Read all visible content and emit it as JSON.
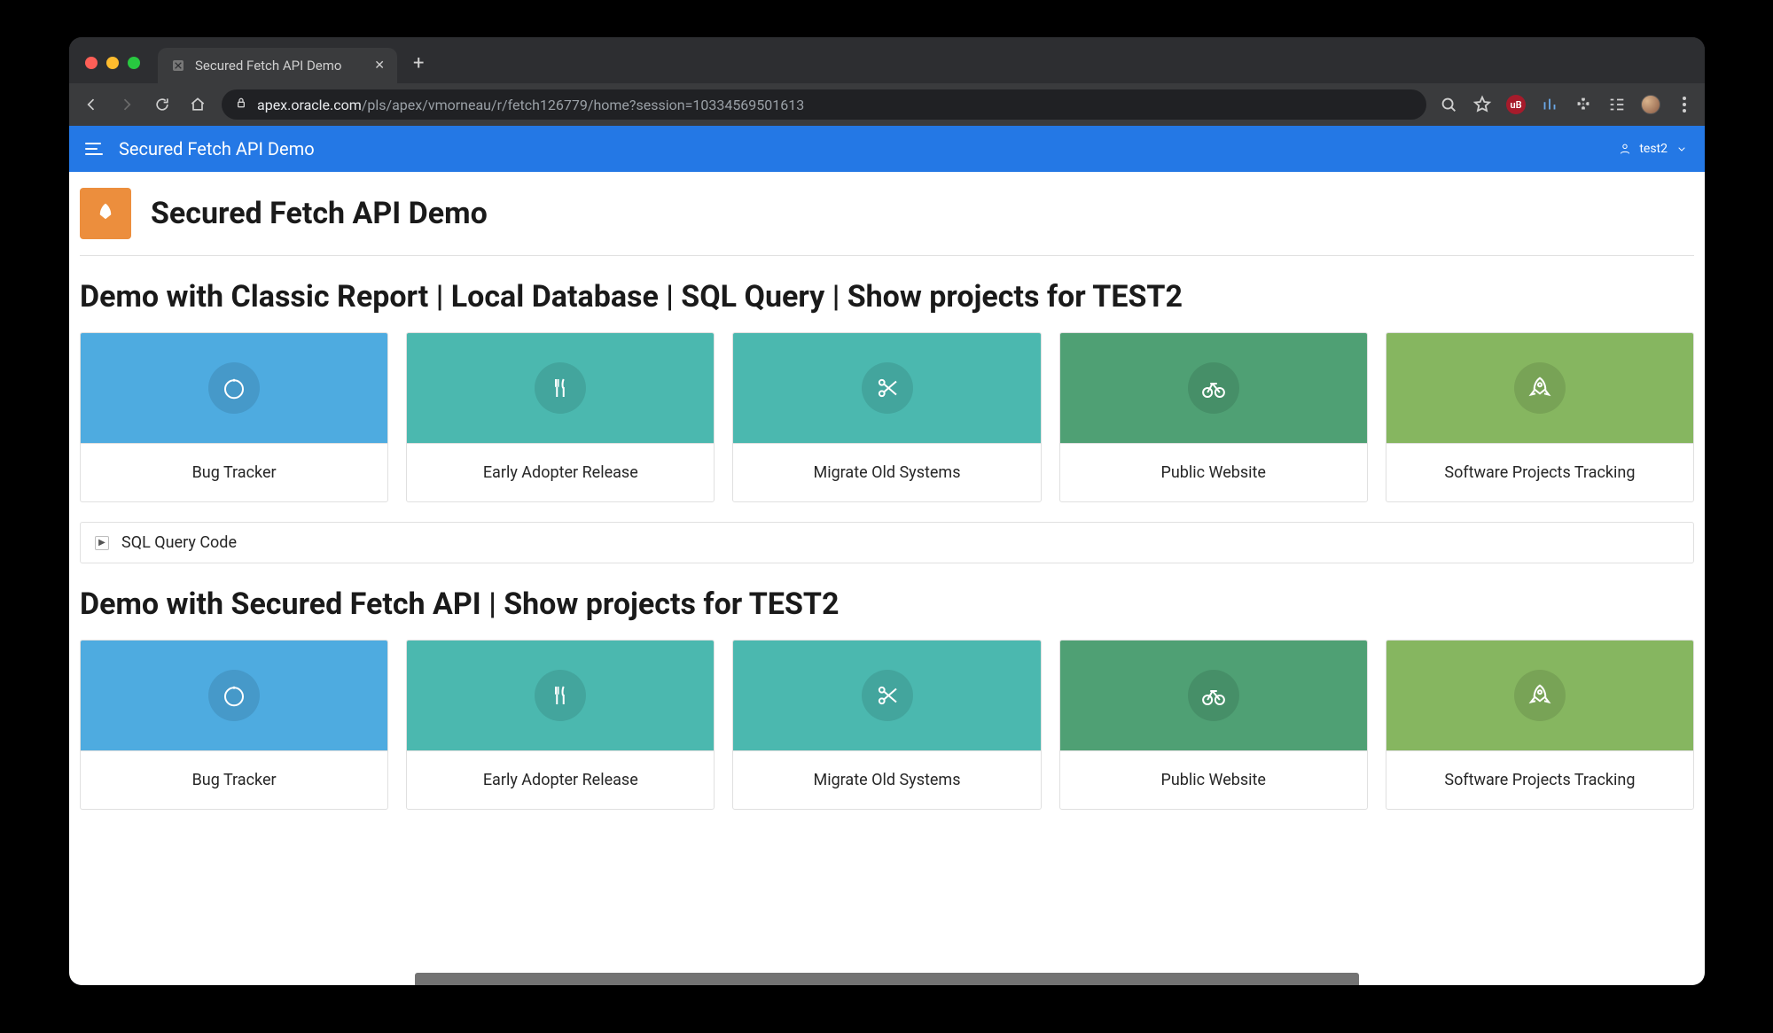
{
  "browser": {
    "tab_title": "Secured Fetch API Demo",
    "url_host": "apex.oracle.com",
    "url_path": "/pls/apex/vmorneau/r/fetch126779/home?session=10334569501613",
    "ext_badge": "uB"
  },
  "app": {
    "header_title": "Secured Fetch API Demo",
    "user": "test2",
    "page_title": "Secured Fetch API Demo"
  },
  "icons": {
    "card": [
      "refresh-icon",
      "utensils-icon",
      "scissors-icon",
      "bicycle-icon",
      "rocket-icon"
    ]
  },
  "sections": [
    {
      "title": "Demo with Classic Report | Local Database | SQL Query | Show projects for TEST2",
      "expander": "SQL Query Code",
      "cards": [
        {
          "label": "Bug Tracker",
          "color": "blue",
          "icon": "refresh-icon"
        },
        {
          "label": "Early Adopter Release",
          "color": "teal",
          "icon": "utensils-icon"
        },
        {
          "label": "Migrate Old Systems",
          "color": "teal",
          "icon": "scissors-icon"
        },
        {
          "label": "Public Website",
          "color": "green",
          "icon": "bicycle-icon"
        },
        {
          "label": "Software Projects Tracking",
          "color": "olive",
          "icon": "rocket-icon"
        }
      ]
    },
    {
      "title": "Demo with Secured Fetch API | Show projects for TEST2",
      "cards": [
        {
          "label": "Bug Tracker",
          "color": "blue",
          "icon": "refresh-icon"
        },
        {
          "label": "Early Adopter Release",
          "color": "teal",
          "icon": "utensils-icon"
        },
        {
          "label": "Migrate Old Systems",
          "color": "teal",
          "icon": "scissors-icon"
        },
        {
          "label": "Public Website",
          "color": "green",
          "icon": "bicycle-icon"
        },
        {
          "label": "Software Projects Tracking",
          "color": "olive",
          "icon": "rocket-icon"
        }
      ]
    }
  ]
}
